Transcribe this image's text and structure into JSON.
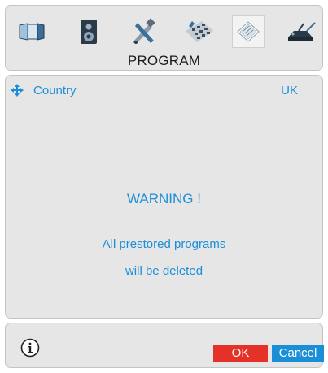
{
  "toolbar": {
    "icons": [
      {
        "name": "picture-icon"
      },
      {
        "name": "speaker-icon"
      },
      {
        "name": "tools-icon"
      },
      {
        "name": "keypad-icon"
      },
      {
        "name": "program-icon",
        "selected": true
      },
      {
        "name": "antenna-icon"
      }
    ]
  },
  "header": {
    "title": "PROGRAM"
  },
  "setting": {
    "label": "Country",
    "value": "UK"
  },
  "warning": {
    "title": "WARNING !",
    "line1": "All prestored programs",
    "line2": "will be deleted"
  },
  "footer": {
    "ok_label": "OK",
    "cancel_label": "Cancel"
  },
  "colors": {
    "accent_blue": "#1b8ed8",
    "ok_red": "#e53228",
    "panel_bg": "#e6e6e6"
  }
}
